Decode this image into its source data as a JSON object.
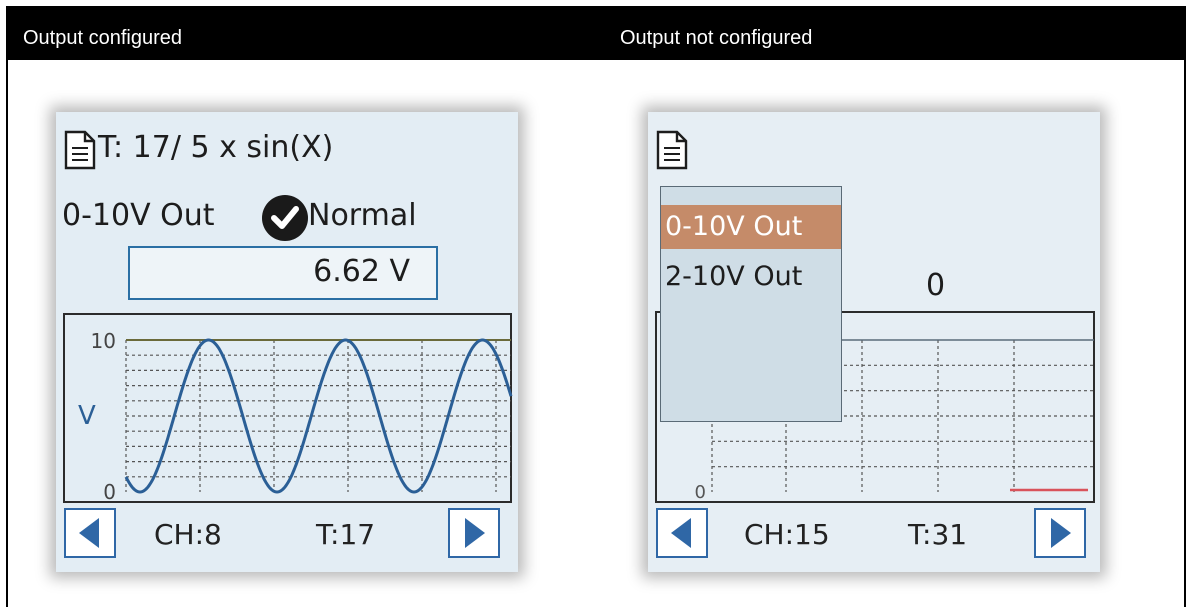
{
  "header": {
    "left_label": "Output configured",
    "right_label": "Output not configured"
  },
  "screen_a": {
    "title": "T: 17/ 5 x sin(X)",
    "output_label": "0-10V Out",
    "status_label": "Normal",
    "value": "6.62  V",
    "plot": {
      "y_max_label": "10",
      "y_min_label": "0",
      "y_unit_label": "V",
      "wave_color": "#2b5f96",
      "ref_line_color": "#6a6a3a"
    },
    "footer": {
      "channel": "CH:8",
      "time": "T:17"
    }
  },
  "screen_b": {
    "dropdown_options": [
      "0-10V Out",
      "2-10V Out"
    ],
    "selected_option": "0-10V Out",
    "value_partial": "0",
    "plot": {
      "y_min_label": "0",
      "trace_color": "#d9535b"
    },
    "footer": {
      "channel": "CH:15",
      "time": "T:31"
    }
  },
  "colors": {
    "screen_bg": "#e3edf4",
    "accent": "#2f67a6",
    "selected_bg": "#c58b69"
  }
}
